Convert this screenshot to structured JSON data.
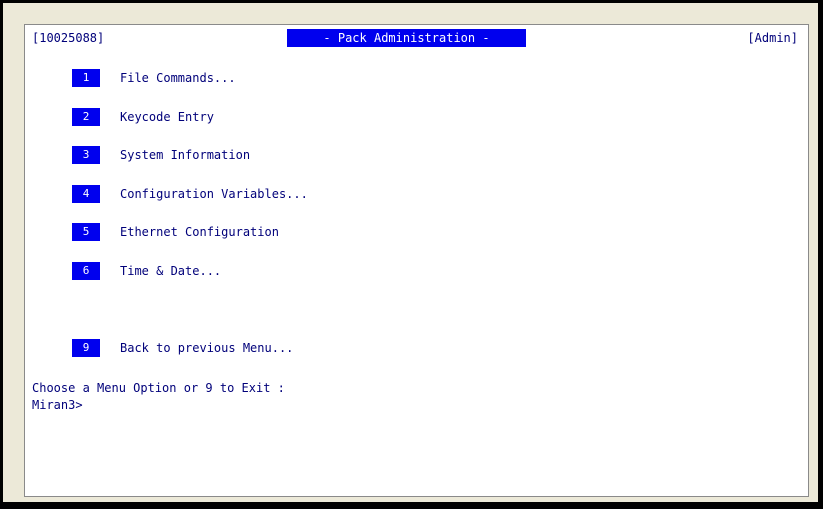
{
  "header": {
    "session_id": "[10025088]",
    "title": "- Pack Administration -",
    "user": "[Admin]"
  },
  "menu": {
    "options": [
      {
        "num": "1",
        "label": "File Commands..."
      },
      {
        "num": "2",
        "label": "Keycode Entry"
      },
      {
        "num": "3",
        "label": "System Information"
      },
      {
        "num": "4",
        "label": "Configuration Variables..."
      },
      {
        "num": "5",
        "label": "Ethernet Configuration"
      },
      {
        "num": "6",
        "label": "Time & Date..."
      },
      {
        "num": "9",
        "label": "Back to previous Menu..."
      }
    ]
  },
  "prompt": {
    "text": "Choose a Menu Option or 9 to Exit :",
    "command_line": "Miran3>"
  },
  "colors": {
    "highlight_bg": "#0000ee",
    "text": "#00007a"
  }
}
